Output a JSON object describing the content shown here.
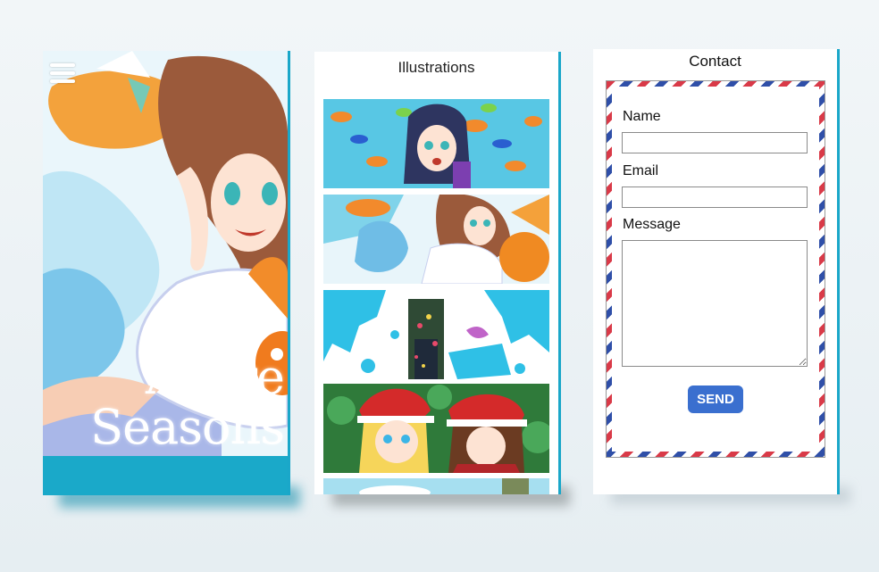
{
  "hero": {
    "menu_icon": "hamburger-menu-icon",
    "title_line1": "Azure",
    "title_line2": "Seasons",
    "accent": "#1aa9c9"
  },
  "gallery": {
    "heading": "Illustrations",
    "items": [
      {
        "name": "fish-girl-illustration"
      },
      {
        "name": "goldfish-girl-illustration"
      },
      {
        "name": "paint-splash-illustration"
      },
      {
        "name": "christmas-couple-illustration"
      },
      {
        "name": "sky-illustration"
      }
    ]
  },
  "contact": {
    "heading": "Contact",
    "name_label": "Name",
    "email_label": "Email",
    "message_label": "Message",
    "name_value": "",
    "email_value": "",
    "message_value": "",
    "send_label": "SEND",
    "border_colors": [
      "#d93a48",
      "#2f4fa8"
    ]
  }
}
